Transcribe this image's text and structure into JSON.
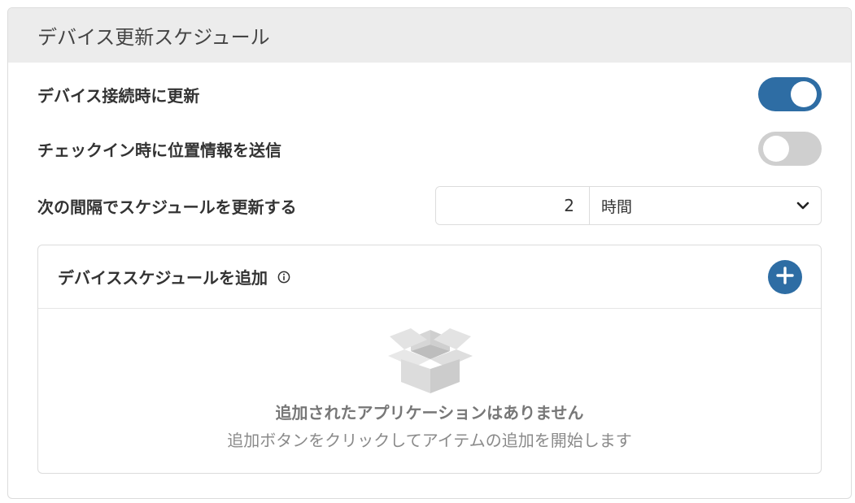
{
  "panel": {
    "title": "デバイス更新スケジュール"
  },
  "settings": {
    "update_on_connect": {
      "label": "デバイス接続時に更新",
      "enabled": true
    },
    "send_location_on_checkin": {
      "label": "チェックイン時に位置情報を送信",
      "enabled": false
    },
    "schedule_interval": {
      "label": "次の間隔でスケジュールを更新する",
      "value": "2",
      "unit": "時間"
    }
  },
  "schedule_section": {
    "title": "デバイススケジュールを追加",
    "info_icon": "info-icon",
    "add_icon": "plus-icon",
    "empty_title": "追加されたアプリケーションはありません",
    "empty_subtitle": "追加ボタンをクリックしてアイテムの追加を開始します"
  },
  "colors": {
    "accent": "#2e6da4",
    "toggle_off": "#cfcfcf",
    "header_bg": "#ececec"
  }
}
